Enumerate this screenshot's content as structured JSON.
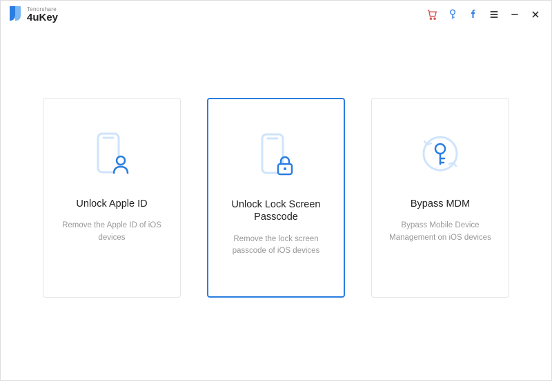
{
  "brand": {
    "company": "Tenorshare",
    "app": "4uKey"
  },
  "cards": [
    {
      "title": "Unlock Apple ID",
      "desc": "Remove the Apple ID of iOS devices"
    },
    {
      "title": "Unlock Lock Screen Passcode",
      "desc": "Remove the lock screen passcode of iOS devices"
    },
    {
      "title": "Bypass MDM",
      "desc": "Bypass Mobile Device Management on iOS devices"
    }
  ]
}
